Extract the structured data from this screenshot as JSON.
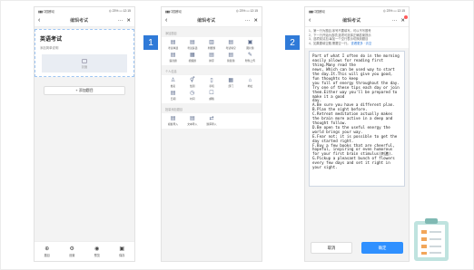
{
  "status": {
    "signal": "▮▮▮ 中国移动",
    "right": "◎ 23% ▭ 12:15"
  },
  "steps": [
    "1",
    "2"
  ],
  "phone1": {
    "nav_title": "编辑考试",
    "exam_title": "英语考试",
    "exam_desc": "添加简单说明",
    "cover_label": "封面",
    "add_button": "+ 添加题目",
    "bottom": [
      {
        "icon": "⊕",
        "label": "题目"
      },
      {
        "icon": "⚙",
        "label": "设置"
      },
      {
        "icon": "◉",
        "label": "预览"
      },
      {
        "icon": "▣",
        "label": "保存"
      }
    ]
  },
  "phone2": {
    "nav_title": "编辑考试",
    "sections": [
      {
        "title": "添加题目",
        "items": [
          {
            "icon": "▤",
            "label": "考试单选"
          },
          {
            "icon": "▤",
            "label": "考试多选"
          },
          {
            "icon": "▥",
            "label": "判断题"
          },
          {
            "icon": "▤",
            "label": "考试填空"
          },
          {
            "icon": "▣",
            "label": "图片题"
          },
          {
            "icon": "▤",
            "label": "语音题"
          },
          {
            "icon": "▦",
            "label": "视频题"
          },
          {
            "icon": "▤",
            "label": "排序"
          },
          {
            "icon": "▤",
            "label": "简答题"
          },
          {
            "icon": "✎",
            "label": "附件上传"
          }
        ]
      },
      {
        "title": "个人信息",
        "items": [
          {
            "icon": "♙",
            "label": "姓名"
          },
          {
            "icon": "⚥",
            "label": "性别"
          },
          {
            "icon": "▯",
            "label": "手机"
          },
          {
            "icon": "▦",
            "label": "部门"
          },
          {
            "icon": "⌂",
            "label": "地址"
          },
          {
            "icon": "▤",
            "label": "日期"
          },
          {
            "icon": "◷",
            "label": "时间"
          },
          {
            "icon": "☐",
            "label": "邮箱"
          }
        ]
      },
      {
        "title": "批量添加题目",
        "items": [
          {
            "icon": "▤",
            "label": "模板导入"
          },
          {
            "icon": "▤",
            "label": "文本导入"
          },
          {
            "icon": "⇄",
            "label": "题库导入"
          }
        ]
      }
    ]
  },
  "phone3": {
    "nav_title": "编辑考试",
    "tips": [
      "1、第一行为题目,序号不要填写。可以不写题号",
      "2、下一行开始为选项,选项可选择正确答案提示",
      "3、选项前请加,每加一个空行表示切换到题目",
      "4、如果要填空题,需要空一行。"
    ],
    "tips_link": "查看更多 · 清空",
    "passage": "Part of what I often do in the morning easily allows for reading first thing.Many read the\nnews, Which can be used way to start the day.It.This will give you good, fun thoughts to keep\nyou full of energy throughout the day.\nTry one of these tips each day or join them.Either way you'll be prepared to make it a good\nday.\nA.Be sure you have a different plan.\nB.Plan the night before.\nC.Retreat meditation actually makes the brain more active in a deep and thought follow.\nD.Be open to the useful energy the world brings your way.\nE.Fear not; it is possible to get the day started right.\nF.Buy a few books that are cheerful, hopeful, inspiring or even humorous for your first brain stimulus(刺激).\nG.Pickup a pleasant bunch of flowers every few days and set it right in your sight.",
    "cancel": "取消",
    "confirm": "确定"
  },
  "colors": {
    "accent": "#2f90ff",
    "step_badge": "#2f7ad8"
  }
}
